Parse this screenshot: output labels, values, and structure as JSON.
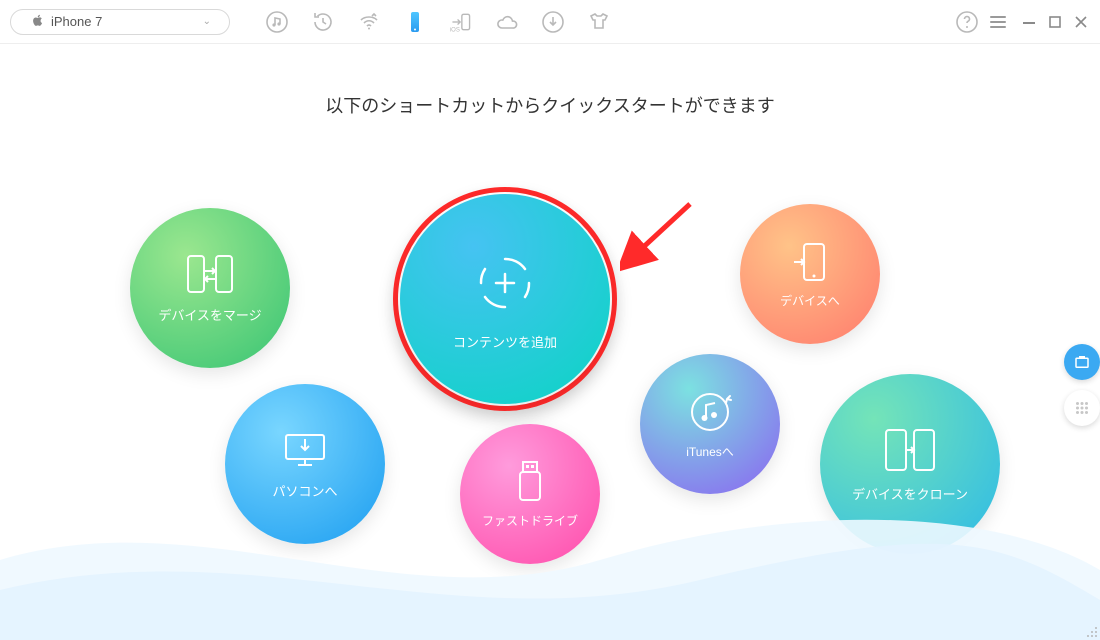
{
  "device_selector": {
    "name": "iPhone 7"
  },
  "toolbar": {
    "tabs": [
      {
        "key": "music",
        "active": false
      },
      {
        "key": "history",
        "active": false
      },
      {
        "key": "wifi",
        "active": false
      },
      {
        "key": "phone",
        "active": true
      },
      {
        "key": "to-ios",
        "active": false
      },
      {
        "key": "icloud",
        "active": false
      },
      {
        "key": "download",
        "active": false
      },
      {
        "key": "tshirt",
        "active": false
      }
    ],
    "ios_text": "iOS"
  },
  "heading": "以下のショートカットからクイックスタートができます",
  "shortcuts": {
    "merge": {
      "label": "デバイスをマージ"
    },
    "pc": {
      "label": "パソコンへ"
    },
    "add": {
      "label": "コンテンツを追加"
    },
    "fast": {
      "label": "ファストドライブ"
    },
    "itunes": {
      "label": "iTunesへ"
    },
    "device": {
      "label": "デバイスへ"
    },
    "clone": {
      "label": "デバイスをクローン"
    }
  },
  "side_rail": {
    "toolbox_active": true
  }
}
